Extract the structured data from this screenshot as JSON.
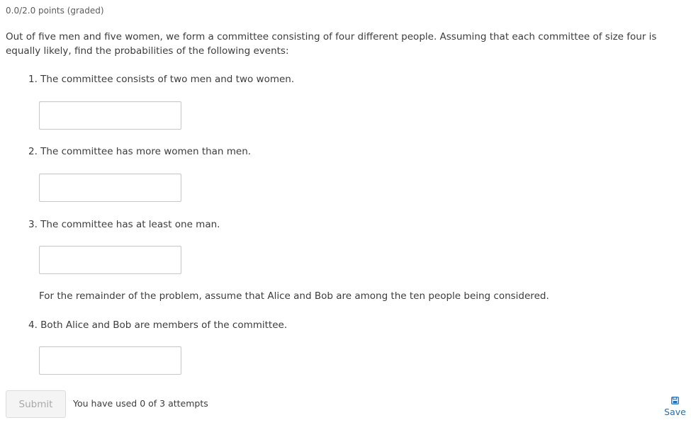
{
  "problem": {
    "points": "0.0/2.0 points (graded)",
    "intro": "Out of five men and five women, we form a committee consisting of four different people. Assuming that each committee of size four is equally likely, find the probabilities of the following events:",
    "items": [
      {
        "label": "1. The committee consists of two men and two women.",
        "value": "",
        "placeholder": ""
      },
      {
        "label": "2. The committee has more women than men.",
        "value": "",
        "placeholder": ""
      },
      {
        "label": "3. The committee has at least one man.",
        "value": "",
        "placeholder": ""
      },
      {
        "label": "4. Both Alice and Bob are members of the committee.",
        "value": "",
        "placeholder": ""
      }
    ],
    "note": "For the remainder of the problem, assume that Alice and Bob are among the ten people being considered."
  },
  "actions": {
    "submit_label": "Submit",
    "attempts_text": "You have used 0 of 3 attempts",
    "save_label": "Save",
    "save_icon": "floppy-disk-icon"
  },
  "colors": {
    "text": "#3c3c3c",
    "link": "#1f6fb5",
    "disabled_text": "#a9a9a9",
    "input_border": "#c8c8c8"
  }
}
